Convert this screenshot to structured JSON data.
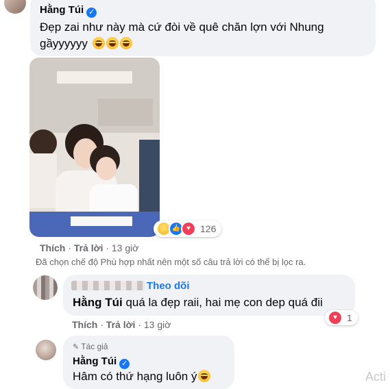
{
  "comment1": {
    "author": "Hằng Túi",
    "text": "Đẹp zai như này mà cứ đòi về quê chăn lợn với Nhung gầyyyyyy"
  },
  "photo_reactions": {
    "count": "126"
  },
  "comment1_actions": {
    "like": "Thích",
    "reply": "Trả lời",
    "sep": "·",
    "time": "13 giờ"
  },
  "filter_notice": "Đã chọn chế độ Phù hợp nhất nên một số câu trả lời có thể bị lọc ra.",
  "comment2": {
    "follow": "Theo dõi",
    "mention": "Hằng Túi",
    "text": " quá la đẹp raii, hai mẹ con dep quá đii",
    "reaction_count": "1"
  },
  "comment2_actions": {
    "like": "Thích",
    "reply": "Trả lời",
    "sep": "·",
    "time": "13 giờ"
  },
  "comment3": {
    "badge": "Tác giả",
    "author": "Hằng Túi",
    "text": "Hâm có thứ hạng luôn ý"
  },
  "watermark": "Acti",
  "colors": {
    "bubble": "#f0f2f5",
    "link": "#1877f2",
    "meta": "#65676b"
  }
}
